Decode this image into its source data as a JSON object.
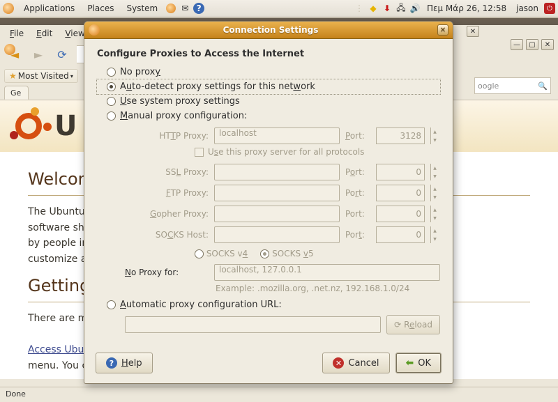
{
  "panel": {
    "applications": "Applications",
    "places": "Places",
    "system": "System",
    "clock": "Πεμ Μάρ 26, 12:58",
    "username": "jason"
  },
  "firefox": {
    "menubar": {
      "file": "File",
      "edit": "Edit",
      "view": "View"
    },
    "bookmarks": {
      "most_visited": "Most Visited"
    },
    "tabs": {
      "tab0": "Ge"
    },
    "search_placeholder": "oogle",
    "status": "Done",
    "page": {
      "logo_text": "U",
      "welcome_heading": "Welcom",
      "welcome_para": "The Ubuntu",
      "welcome_para2": "software sho",
      "welcome_para3": "by people in",
      "welcome_para4": "customize a",
      "getting_heading": "Getting H",
      "getting_para": "There are m",
      "access_para": "Access Ubu",
      "access_para2": "menu. You c"
    }
  },
  "dialog": {
    "title": "Connection Settings",
    "heading": "Configure Proxies to Access the Internet",
    "radio": {
      "no_proxy": "No proxy",
      "autodetect": "Auto-detect proxy settings for this network",
      "system": "Use system proxy settings",
      "manual": "Manual proxy configuration:",
      "autourl": "Automatic proxy configuration URL:"
    },
    "fields": {
      "http_label": "HTTP Proxy:",
      "http_value": "localhost",
      "http_port": "3128",
      "ssl_label": "SSL Proxy:",
      "ssl_value": "",
      "ssl_port": "0",
      "ftp_label": "FTP Proxy:",
      "ftp_value": "",
      "ftp_port": "0",
      "gopher_label": "Gopher Proxy:",
      "gopher_value": "",
      "gopher_port": "0",
      "socks_label": "SOCKS Host:",
      "socks_value": "",
      "socks_port": "0",
      "port_label": "Port:",
      "use_all": "Use this proxy server for all protocols",
      "socks_v4": "SOCKS v4",
      "socks_v5": "SOCKS v5",
      "noproxy_label": "No Proxy for:",
      "noproxy_value": "localhost, 127.0.0.1",
      "example": "Example: .mozilla.org, .net.nz, 192.168.1.0/24",
      "reload": "Reload"
    },
    "buttons": {
      "help": "Help",
      "cancel": "Cancel",
      "ok": "OK"
    }
  }
}
